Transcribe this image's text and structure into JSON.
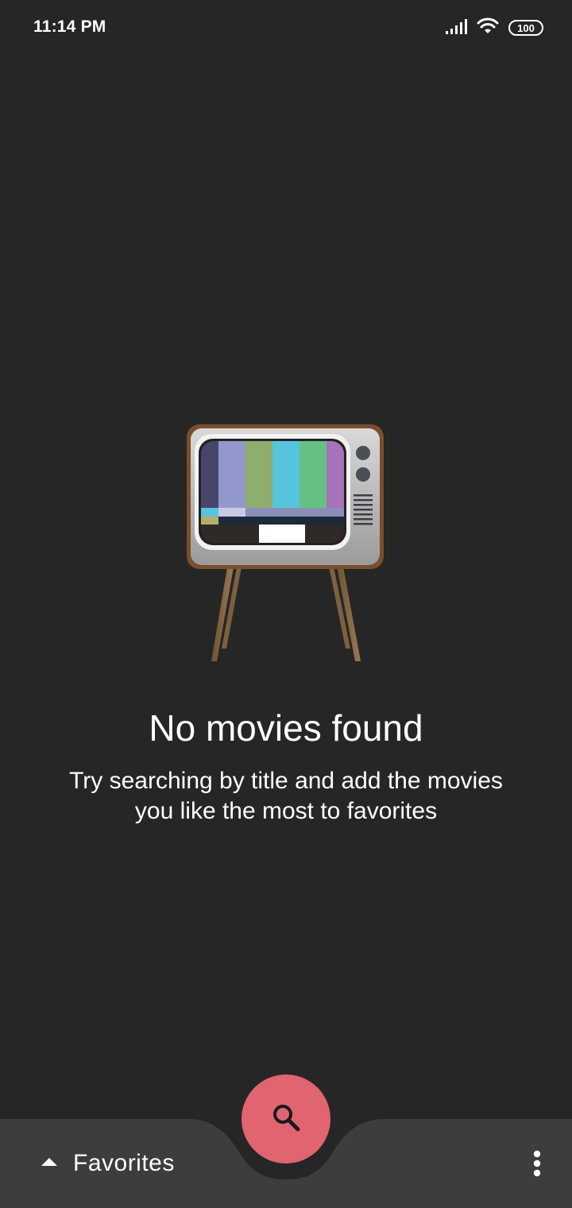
{
  "status_bar": {
    "time": "11:14 PM",
    "battery_level": "100",
    "icons": [
      "signal-icon",
      "wifi-icon",
      "battery-icon"
    ]
  },
  "empty_state": {
    "illustration": "retro-tv-icon",
    "title": "No movies found",
    "message": "Try searching by title and add the movies you like the most to favorites"
  },
  "bottom_bar": {
    "favorites_label": "Favorites",
    "favorites_icon": "caret-up-icon",
    "more_icon": "more-vert-icon",
    "fab_icon": "search-icon"
  },
  "colors": {
    "background": "#262626",
    "bottom_bar": "#3d3d3d",
    "fab": "#e06570"
  }
}
